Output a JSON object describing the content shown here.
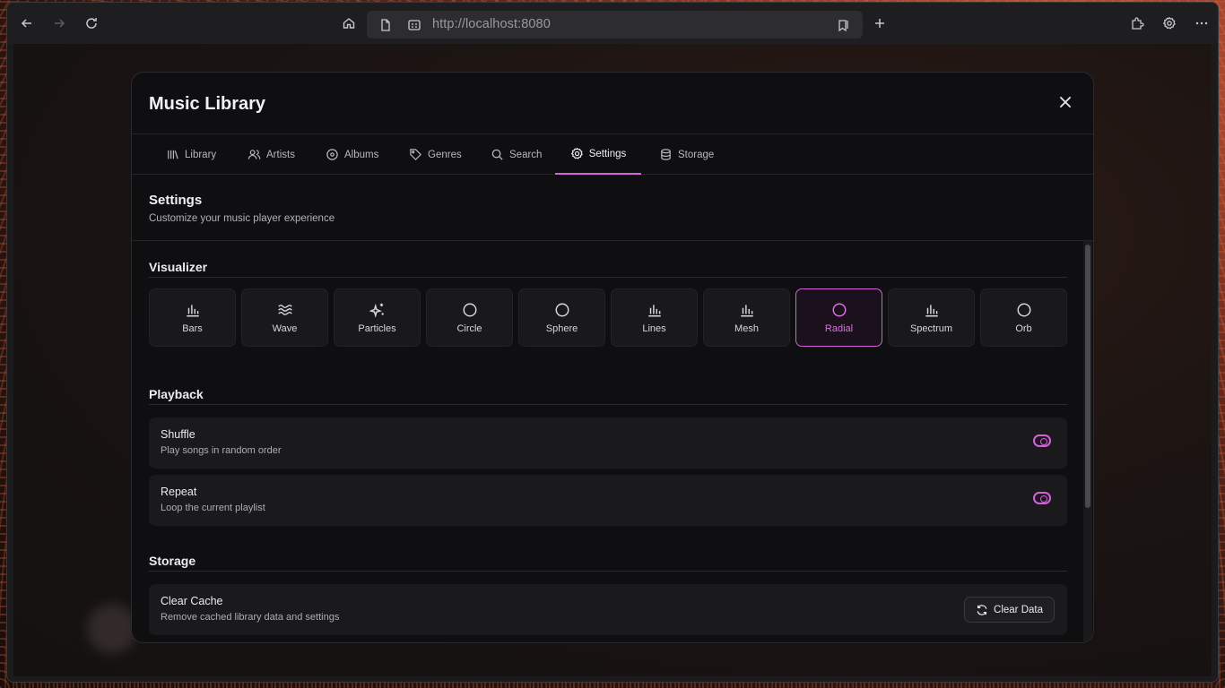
{
  "browser": {
    "url": "http://localhost:8080"
  },
  "modal": {
    "title": "Music Library",
    "tabs": [
      {
        "label": "Library",
        "icon": "library-icon"
      },
      {
        "label": "Artists",
        "icon": "users-icon"
      },
      {
        "label": "Albums",
        "icon": "disc-icon"
      },
      {
        "label": "Genres",
        "icon": "tag-icon"
      },
      {
        "label": "Search",
        "icon": "search-icon"
      },
      {
        "label": "Settings",
        "icon": "gear-icon",
        "active": true
      },
      {
        "label": "Storage",
        "icon": "database-icon"
      }
    ]
  },
  "settings": {
    "title": "Settings",
    "subtitle": "Customize your music player experience"
  },
  "visualizer": {
    "title": "Visualizer",
    "options": [
      {
        "label": "Bars",
        "icon": "bar-chart-icon"
      },
      {
        "label": "Wave",
        "icon": "waves-icon"
      },
      {
        "label": "Particles",
        "icon": "sparkles-icon"
      },
      {
        "label": "Circle",
        "icon": "circle-icon"
      },
      {
        "label": "Sphere",
        "icon": "circle-icon"
      },
      {
        "label": "Lines",
        "icon": "bar-chart-icon"
      },
      {
        "label": "Mesh",
        "icon": "bar-chart-icon"
      },
      {
        "label": "Radial",
        "icon": "circle-icon",
        "selected": true
      },
      {
        "label": "Spectrum",
        "icon": "bar-chart-icon"
      },
      {
        "label": "Orb",
        "icon": "circle-icon"
      }
    ]
  },
  "playback": {
    "title": "Playback",
    "shuffle": {
      "label": "Shuffle",
      "description": "Play songs in random order",
      "enabled": true
    },
    "repeat": {
      "label": "Repeat",
      "description": "Loop the current playlist",
      "enabled": true
    }
  },
  "storage": {
    "title": "Storage",
    "clear_cache": {
      "label": "Clear Cache",
      "description": "Remove cached library data and settings",
      "button": "Clear Data"
    }
  },
  "colors": {
    "accent": "#d95fdd"
  }
}
